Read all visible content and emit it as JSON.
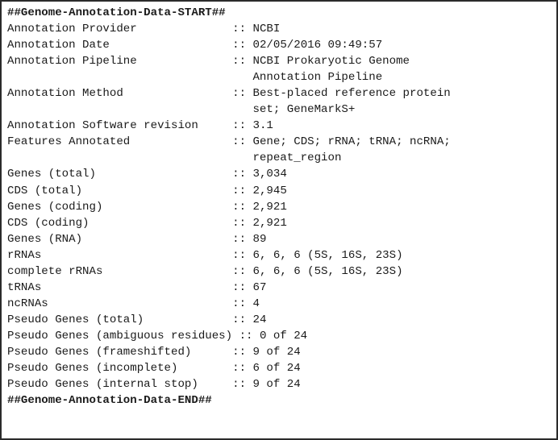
{
  "document": {
    "type": "genome-annotation-data-block",
    "start_marker": "##Genome-Annotation-Data-START##",
    "end_marker": "##Genome-Annotation-Data-END##",
    "separator": "::",
    "label_column_width": 33,
    "entries": [
      {
        "label": "Annotation Provider",
        "value": "NCBI",
        "continuation": []
      },
      {
        "label": "Annotation Date",
        "value": "02/05/2016 09:49:57",
        "continuation": []
      },
      {
        "label": "Annotation Pipeline",
        "value": "NCBI Prokaryotic Genome",
        "continuation": [
          "Annotation Pipeline"
        ]
      },
      {
        "label": "Annotation Method",
        "value": "Best-placed reference protein",
        "continuation": [
          "set; GeneMarkS+"
        ]
      },
      {
        "label": "Annotation Software revision",
        "value": "3.1",
        "continuation": []
      },
      {
        "label": "Features Annotated",
        "value": "Gene; CDS; rRNA; tRNA; ncRNA;",
        "continuation": [
          "repeat_region"
        ]
      },
      {
        "label": "Genes (total)",
        "value": "3,034",
        "continuation": []
      },
      {
        "label": "CDS (total)",
        "value": "2,945",
        "continuation": []
      },
      {
        "label": "Genes (coding)",
        "value": "2,921",
        "continuation": []
      },
      {
        "label": "CDS (coding)",
        "value": "2,921",
        "continuation": []
      },
      {
        "label": "Genes (RNA)",
        "value": "89",
        "continuation": []
      },
      {
        "label": "rRNAs",
        "value": "6, 6, 6 (5S, 16S, 23S)",
        "continuation": []
      },
      {
        "label": "complete rRNAs",
        "value": "6, 6, 6 (5S, 16S, 23S)",
        "continuation": []
      },
      {
        "label": "tRNAs",
        "value": "67",
        "continuation": []
      },
      {
        "label": "ncRNAs",
        "value": "4",
        "continuation": []
      },
      {
        "label": "Pseudo Genes (total)",
        "value": "24",
        "continuation": []
      },
      {
        "label": "Pseudo Genes (ambiguous residues)",
        "value": "0 of 24",
        "continuation": []
      },
      {
        "label": "Pseudo Genes (frameshifted)",
        "value": "9 of 24",
        "continuation": []
      },
      {
        "label": "Pseudo Genes (incomplete)",
        "value": "6 of 24",
        "continuation": []
      },
      {
        "label": "Pseudo Genes (internal stop)",
        "value": "9 of 24",
        "continuation": []
      }
    ]
  }
}
